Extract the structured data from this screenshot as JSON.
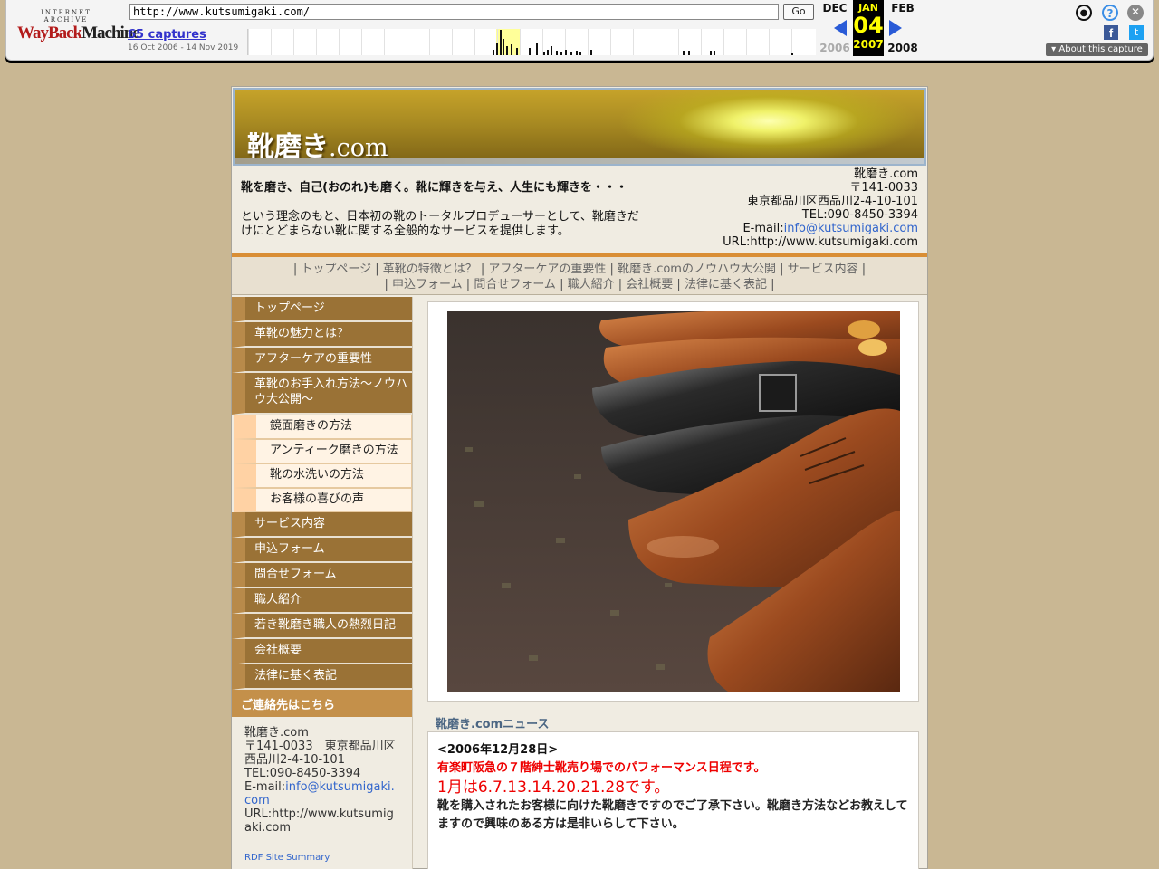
{
  "wayback": {
    "logo_top": "INTERNET ARCHIVE",
    "logo_wayback": "WayBack",
    "logo_machine": "Machine",
    "url": "http://www.kutsumigaki.com/",
    "go_label": "Go",
    "captures": "65 captures",
    "range": "16 Oct 2006 - 14 Nov 2019",
    "prev_month": "DEC",
    "cur_month": "JAN",
    "next_month": "FEB",
    "cur_day": "04",
    "prev_year": "2006",
    "cur_year": "2007",
    "next_year": "2008",
    "about": "About this capture",
    "facebook": "f",
    "twitter": "t",
    "help": "?",
    "close": "✕",
    "user": "●"
  },
  "site": {
    "logo_kanji": "靴磨き",
    "logo_domain": ".com",
    "intro_tagline": "靴を磨き、自己(おのれ)も磨く。靴に輝きを与え、人生にも輝きを・・・",
    "intro_body": "という理念のもと、日本初の靴のトータルプロデューサーとして、靴磨きだけにとどまらない靴に関する全般的なサービスを提供します。",
    "contact": {
      "name": "靴磨き.com",
      "zip": "〒141-0033",
      "address": "東京都品川区西品川2-4-10-101",
      "tel": "TEL:090-8450-3394",
      "email_label": "E-mail:",
      "email": "info@kutsumigaki.com",
      "url": "URL:http://www.kutsumigaki.com"
    },
    "topnav": [
      "トップページ",
      "革靴の特徴とは？",
      "アフターケアの重要性",
      "靴磨き.comのノウハウ大公開",
      "サービス内容",
      "申込フォーム",
      "問合せフォーム",
      "職人紹介",
      "会社概要",
      "法律に基く表記"
    ],
    "sidebar": {
      "main1": [
        "トップページ",
        "革靴の魅力とは？",
        "アフターケアの重要性",
        "革靴のお手入れ方法～ノウハウ大公開～"
      ],
      "sub": [
        "鏡面磨きの方法",
        "アンティーク磨きの方法",
        "靴の水洗いの方法",
        "お客様の喜びの声"
      ],
      "main2": [
        "サービス内容",
        "申込フォーム",
        "問合せフォーム",
        "職人紹介",
        "若き靴磨き職人の熱烈日記",
        "会社概要",
        "法律に基く表記"
      ],
      "contact_head": "ご連絡先はこちら",
      "contact_name": "靴磨き.com",
      "contact_zip_addr": "〒141-0033　東京都品川区西品川2-4-10-101",
      "contact_tel": "TEL:090-8450-3394",
      "contact_email_label": "E-mail:",
      "contact_email": "info@kutsumigaki.com",
      "contact_url": "URL:http://www.kutsumigaki.com",
      "rdf": "RDF Site Summary"
    },
    "news": {
      "title": "靴磨き.comニュース",
      "date": "<2006年12月28日>",
      "line1": "有楽町阪急の７階紳士靴売り場でのパフォーマンス日程です。",
      "line2": "1月は6.7.13.14.20.21.28です。",
      "line3": "靴を購入されたお客様に向けた靴磨きですのでご了承下さい。靴磨き方法などお教えしてますので興味のある方は是非いらして下さい。"
    }
  }
}
